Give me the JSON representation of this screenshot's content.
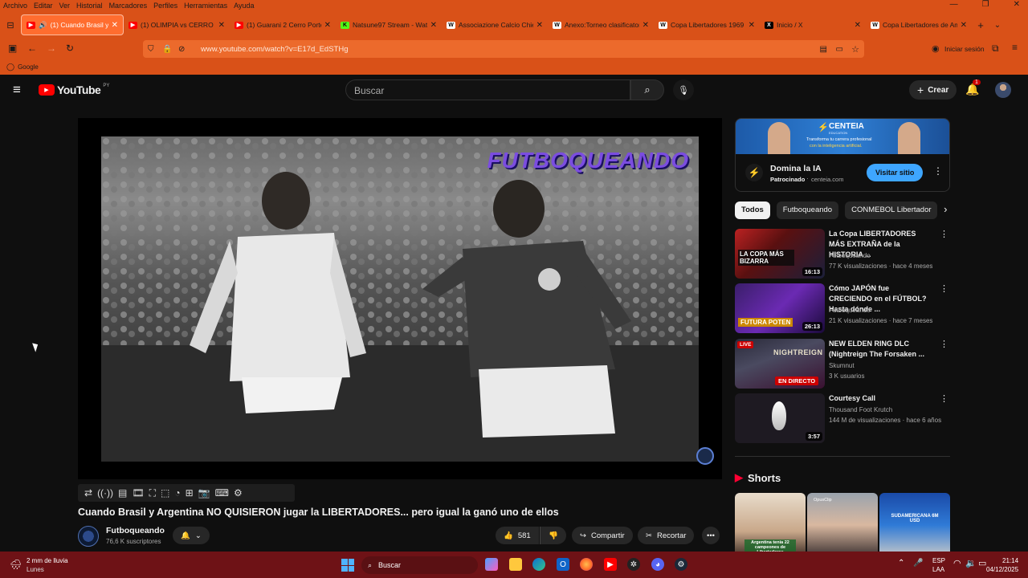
{
  "browser": {
    "menu": [
      "Archivo",
      "Editar",
      "Ver",
      "Historial",
      "Marcadores",
      "Perfiles",
      "Herramientas",
      "Ayuda"
    ],
    "tabs": [
      {
        "title": "(1) Cuando Brasil y Arg",
        "favicon": "youtube-icon",
        "color": "#ff0000"
      },
      {
        "title": "(1) OLIMPIA vs CERRO",
        "favicon": "youtube-icon",
        "color": "#ff0000"
      },
      {
        "title": "(1) Guarani 2 Cerro Porteño",
        "favicon": "youtube-icon",
        "color": "#ff0000"
      },
      {
        "title": "Natsune97 Stream - Watch",
        "favicon": "kick-icon",
        "color": "#53fc18"
      },
      {
        "title": "Associazione Calcio Chievo",
        "favicon": "wikipedia-icon",
        "color": "#ffffff"
      },
      {
        "title": "Anexo:Torneo clasificatorio",
        "favicon": "wikipedia-icon",
        "color": "#ffffff"
      },
      {
        "title": "Copa Libertadores 1969 - W",
        "favicon": "wikipedia-icon",
        "color": "#ffffff"
      },
      {
        "title": "Inicio / X",
        "favicon": "x-icon",
        "color": "#000000"
      },
      {
        "title": "Copa Libertadores de Amé",
        "favicon": "wikipedia-icon",
        "color": "#ffffff"
      }
    ],
    "url": "www.youtube.com/watch?v=E17d_EdSTHg",
    "signin": "Iniciar sesión",
    "bookmark": "Google"
  },
  "youtube": {
    "logo": "YouTube",
    "region": "PY",
    "search_placeholder": "Buscar",
    "create": "Crear",
    "notif_count": "1",
    "watermark": "FUTBOQUEANDO",
    "video_title": "Cuando Brasil y Argentina NO QUISIERON jugar la LIBERTADORES... pero igual la ganó uno de ellos",
    "channel": "Futboqueando",
    "subscribers": "76,6 K suscriptores",
    "likes": "581",
    "share": "Compartir",
    "clip": "Recortar",
    "ad": {
      "brand": "CENTEIA",
      "brand_sub": "EDUCATION",
      "banner_line1": "Transforma tu carrera profesional",
      "banner_line2": "con la inteligencia artificial.",
      "title": "Domina la IA",
      "sponsored": "Patrocinado",
      "domain": "centeia.com",
      "cta": "Visitar sitio"
    },
    "chips": [
      "Todos",
      "Futboqueando",
      "CONMEBOL Libertador"
    ],
    "recs": [
      {
        "title": "La Copa LIBERTADORES MÁS EXTRAÑA de la HISTORIA ...",
        "channel": "Futboqueando",
        "meta": "77 K visualizaciones · hace 4 meses",
        "duration": "16:13",
        "overlay": "LA COPA MÁS BIZARRA"
      },
      {
        "title": "Cómo JAPÓN fue CRECIENDO en el FÚTBOL? Hasta dónde ...",
        "channel": "Futboqueando",
        "meta": "21 K visualizaciones · hace 7 meses",
        "duration": "26:13",
        "overlay": "FUTURA POTEN"
      },
      {
        "title": "NEW ELDEN RING DLC (Nightreign The Forsaken ...",
        "channel": "Skumnut",
        "meta": "3 K usuarios",
        "duration": "",
        "live": "LIVE",
        "live_badge": "EN DIRECTO",
        "overlay": "NIGHTREIGN"
      },
      {
        "title": "Courtesy Call",
        "channel": "Thousand Foot Krutch",
        "meta": "144 M de visualizaciones · hace 6 años",
        "duration": "3:57",
        "overlay": ""
      }
    ],
    "shorts_label": "Shorts",
    "shorts": [
      {
        "caption": "Argentina tenía 22 campeones de Libertadores"
      },
      {
        "caption": "OpusClip"
      },
      {
        "caption": "SUDAMERICANA 6M USD"
      }
    ]
  },
  "taskbar": {
    "weather": "2 mm de lluvia",
    "weather_day": "Lunes",
    "search": "Buscar",
    "lang": "ESP",
    "lang2": "LAA",
    "time": "21:14",
    "date": "04/12/2025"
  }
}
